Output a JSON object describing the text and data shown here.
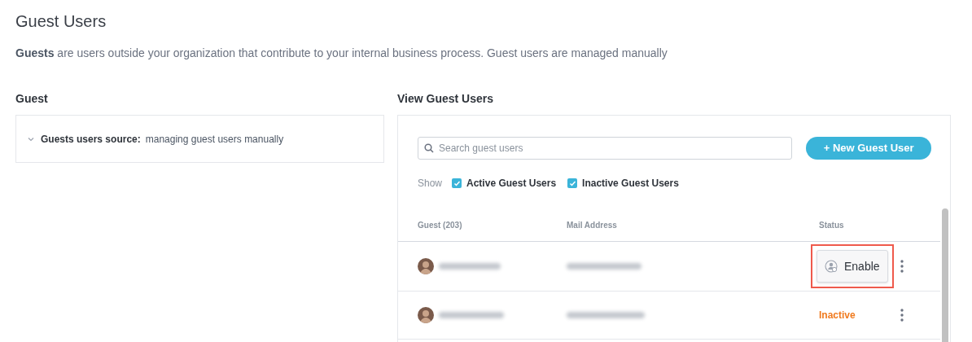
{
  "page": {
    "title": "Guest Users",
    "description": "**Guests** are users outside your organization that contribute to your internal business process. Guest users are managed manually"
  },
  "guest_section": {
    "heading": "Guest",
    "source": {
      "expanded": false,
      "label": "Guests users source:",
      "value": "managing guest users manually"
    }
  },
  "view_section": {
    "heading": "View Guest Users",
    "search": {
      "placeholder": "Search guest users"
    },
    "new_button": "+ New Guest User",
    "filters": {
      "label": "Show",
      "options": [
        {
          "label": "Active Guest Users",
          "checked": true
        },
        {
          "label": "Inactive Guest Users",
          "checked": true
        }
      ]
    },
    "table": {
      "columns": [
        "Guest (203)",
        "Mail Address",
        "Status"
      ],
      "rows": [
        {
          "status": {
            "kind": "button",
            "text": "Enable",
            "highlighted": true
          }
        },
        {
          "status": {
            "kind": "label",
            "text": "Inactive"
          }
        }
      ]
    }
  }
}
